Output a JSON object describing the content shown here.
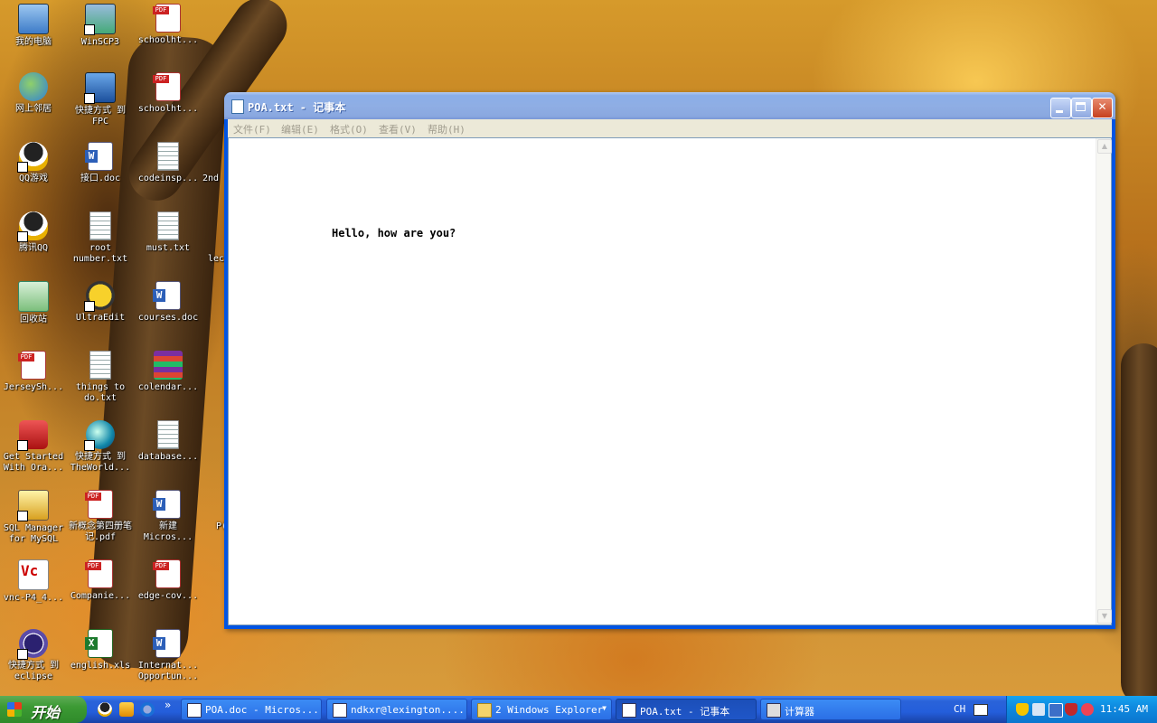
{
  "desktop": {
    "icons": [
      {
        "label": "我的电脑"
      },
      {
        "label": "WinSCP3"
      },
      {
        "label": "schoolht..."
      },
      {
        "label": "网上邻居"
      },
      {
        "label": "快捷方式 到 FPC"
      },
      {
        "label": "schoolht..."
      },
      {
        "label": "QQ游戏"
      },
      {
        "label": "接口.doc"
      },
      {
        "label": "codeinsp..."
      },
      {
        "label": "2nd"
      },
      {
        "label": "腾讯QQ"
      },
      {
        "label": "root number.txt"
      },
      {
        "label": "must.txt"
      },
      {
        "label": "lec"
      },
      {
        "label": "回收站"
      },
      {
        "label": "UltraEdit"
      },
      {
        "label": "courses.doc"
      },
      {
        "label": "JerseySh..."
      },
      {
        "label": "things to do.txt"
      },
      {
        "label": "colendar..."
      },
      {
        "label": "Get Started With Ora..."
      },
      {
        "label": "快捷方式 到 TheWorld..."
      },
      {
        "label": "database..."
      },
      {
        "label": "SQL Manager for MySQL"
      },
      {
        "label": "新概念第四册笔记.pdf"
      },
      {
        "label": "新建 Micros..."
      },
      {
        "label": "P("
      },
      {
        "label": "vnc-P4_4..."
      },
      {
        "label": "Companie..."
      },
      {
        "label": "edge-cov..."
      },
      {
        "label": "快捷方式 到 eclipse"
      },
      {
        "label": "english.xls"
      },
      {
        "label": "Internat... Opportun..."
      }
    ]
  },
  "notepad": {
    "title": "POA.txt - 记事本",
    "menu": [
      "文件(F)",
      "编辑(E)",
      "格式(O)",
      "查看(V)",
      "帮助(H)"
    ],
    "content": "Hello, how are you?"
  },
  "taskbar": {
    "start_label": "开始",
    "quick_launch_more": "»",
    "items": [
      {
        "label": "POA.doc - Micros..."
      },
      {
        "label": "ndkxr@lexington...."
      },
      {
        "label": "2 Windows Explorer"
      },
      {
        "label": "POA.txt - 记事本"
      },
      {
        "label": "计算器"
      }
    ],
    "language": "CH",
    "clock": "11:45 AM"
  }
}
